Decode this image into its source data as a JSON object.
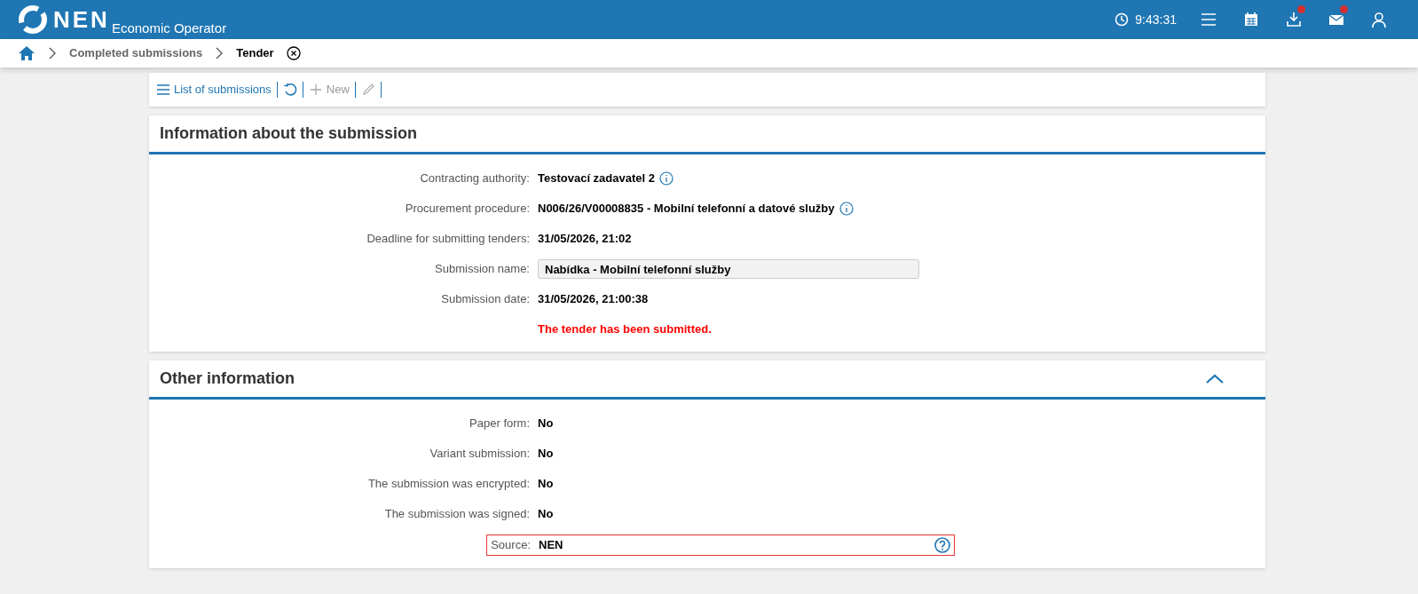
{
  "header": {
    "logo": "NEN",
    "subtitle": "Economic Operator",
    "clock": "9:43:31",
    "icons": [
      {
        "kind": "menu",
        "badge": false
      },
      {
        "kind": "calendar",
        "badge": false
      },
      {
        "kind": "download",
        "badge": true
      },
      {
        "kind": "mail",
        "badge": true
      },
      {
        "kind": "user",
        "badge": false
      }
    ]
  },
  "breadcrumb": {
    "items": [
      {
        "label": "Completed submissions",
        "current": false
      },
      {
        "label": "Tender",
        "current": true
      }
    ]
  },
  "toolbar": [
    {
      "kind": "list",
      "label": "List of submissions",
      "disabled": false
    },
    {
      "kind": "refresh",
      "disabled": false
    },
    {
      "kind": "new",
      "label": "New",
      "disabled": true
    },
    {
      "kind": "edit",
      "disabled": true
    }
  ],
  "sections": [
    {
      "title": "Information about the submission",
      "rows": [
        {
          "kind": "info",
          "label": "Contracting authority:",
          "value": "Testovací zadavatel 2"
        },
        {
          "kind": "info",
          "label": "Procurement procedure:",
          "value": "N006/26/V00008835 - Mobilní telefonní a datové služby"
        },
        {
          "kind": "text",
          "label": "Deadline for submitting tenders:",
          "value": "31/05/2026, 21:02"
        },
        {
          "kind": "field",
          "label": "Submission name:",
          "value": "Nabídka - Mobilní telefonní služby"
        },
        {
          "kind": "text",
          "label": "Submission date:",
          "value": "31/05/2026, 21:00:38"
        },
        {
          "kind": "message",
          "value": "The tender has been submitted."
        }
      ]
    },
    {
      "title": "Other information",
      "expanded": true,
      "rows": [
        {
          "kind": "text",
          "label": "Paper form:",
          "value": "No"
        },
        {
          "kind": "text",
          "label": "Variant submission:",
          "value": "No"
        },
        {
          "kind": "text",
          "label": "The submission was encrypted:",
          "value": "No"
        },
        {
          "kind": "text",
          "label": "The submission was signed:",
          "value": "No"
        },
        {
          "kind": "highlighted",
          "label": "Source:",
          "value": "NEN"
        }
      ]
    }
  ]
}
